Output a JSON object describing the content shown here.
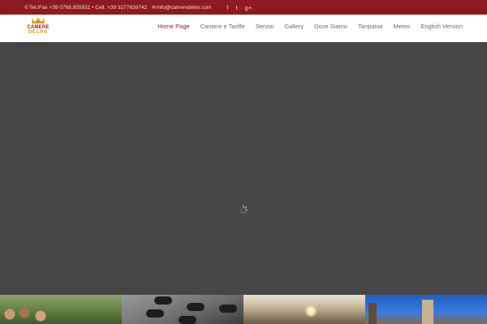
{
  "topbar": {
    "phone": "Tel./Fax +39 0766.855831 • Cell. +39 3277639742",
    "email": "info@cameredelre.com",
    "social": {
      "facebook": "f",
      "twitter": "t",
      "googleplus": "g+"
    },
    "color": "#8e1a1f"
  },
  "logo": {
    "line1": "CAMERE",
    "line2": "DELRE"
  },
  "nav": {
    "items": [
      {
        "label": "Home Page",
        "active": true
      },
      {
        "label": "Camere e Tariffe",
        "active": false
      },
      {
        "label": "Servizi",
        "active": false
      },
      {
        "label": "Gallery",
        "active": false
      },
      {
        "label": "Dove Siamo",
        "active": false
      },
      {
        "label": "Tarquinia",
        "active": false
      },
      {
        "label": "Meteo",
        "active": false
      },
      {
        "label": "English Version",
        "active": false
      }
    ],
    "active_color": "#8e1a1f"
  },
  "hero": {
    "background": "#464646",
    "state": "loading"
  },
  "thumbnails": [
    {
      "subject": "group-photo"
    },
    {
      "subject": "phone-keypad"
    },
    {
      "subject": "room-interior"
    },
    {
      "subject": "town-tower"
    }
  ]
}
